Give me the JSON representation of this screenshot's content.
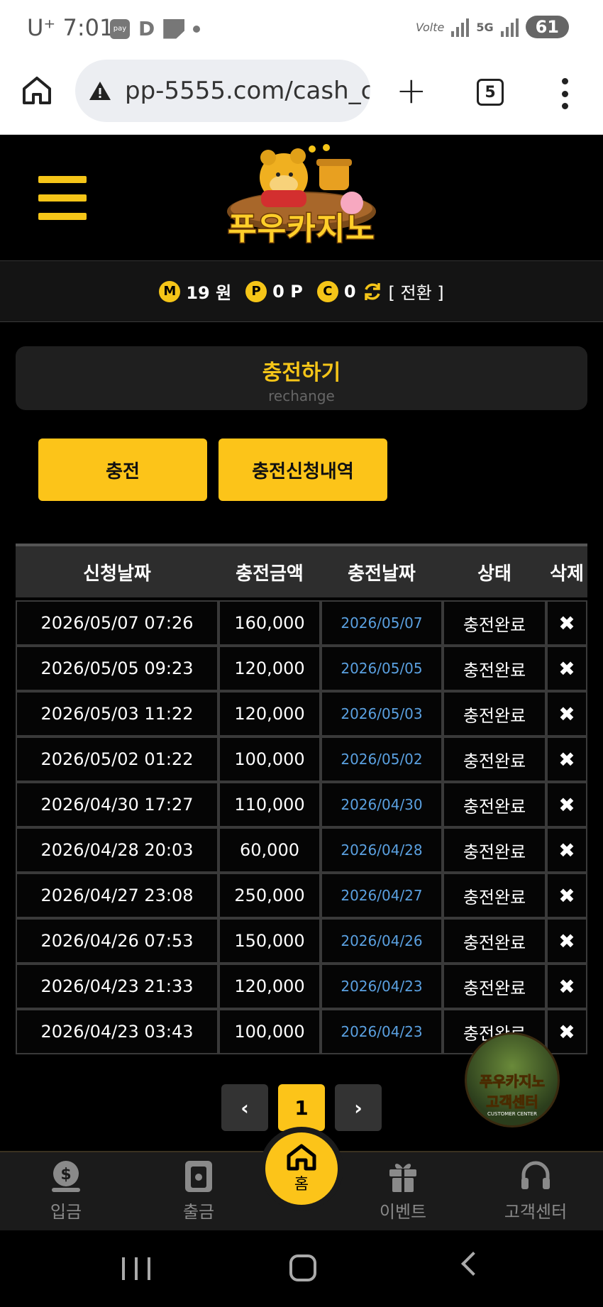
{
  "status_bar": {
    "carrier": "U⁺",
    "time": "7:01",
    "battery": "61",
    "network": "5G",
    "volte": "Volte"
  },
  "browser": {
    "url": "pp-5555.com/cash_c",
    "tab_count": "5"
  },
  "header": {
    "logo_text": "푸우카지노"
  },
  "points": {
    "money_icon": "M",
    "money": "19 원",
    "point_icon": "P",
    "point": "0 P",
    "coin_icon": "C",
    "coin": "0",
    "convert_label": "[ 전환 ]"
  },
  "section": {
    "title": "충전하기",
    "subtitle": "rechange"
  },
  "buttons": {
    "charge": "충전",
    "history": "충전신청내역"
  },
  "table": {
    "headers": [
      "신청날짜",
      "충전금액",
      "충전날짜",
      "상태",
      "삭제"
    ],
    "rows": [
      {
        "req": "2026/05/07 07:26",
        "amount": "160,000",
        "date": "2026/05/07",
        "status": "충전완료",
        "del": "✖"
      },
      {
        "req": "2026/05/05 09:23",
        "amount": "120,000",
        "date": "2026/05/05",
        "status": "충전완료",
        "del": "✖"
      },
      {
        "req": "2026/05/03 11:22",
        "amount": "120,000",
        "date": "2026/05/03",
        "status": "충전완료",
        "del": "✖"
      },
      {
        "req": "2026/05/02 01:22",
        "amount": "100,000",
        "date": "2026/05/02",
        "status": "충전완료",
        "del": "✖"
      },
      {
        "req": "2026/04/30 17:27",
        "amount": "110,000",
        "date": "2026/04/30",
        "status": "충전완료",
        "del": "✖"
      },
      {
        "req": "2026/04/28 20:03",
        "amount": "60,000",
        "date": "2026/04/28",
        "status": "충전완료",
        "del": "✖"
      },
      {
        "req": "2026/04/27 23:08",
        "amount": "250,000",
        "date": "2026/04/27",
        "status": "충전완료",
        "del": "✖"
      },
      {
        "req": "2026/04/26 07:53",
        "amount": "150,000",
        "date": "2026/04/26",
        "status": "충전완료",
        "del": "✖"
      },
      {
        "req": "2026/04/23 21:33",
        "amount": "120,000",
        "date": "2026/04/23",
        "status": "충전완료",
        "del": "✖"
      },
      {
        "req": "2026/04/23 03:43",
        "amount": "100,000",
        "date": "2026/04/23",
        "status": "충전완료",
        "del": "✖"
      }
    ]
  },
  "pagination": {
    "prev": "‹",
    "current": "1",
    "next": "›"
  },
  "floating_support": {
    "title": "푸우카지노",
    "subtitle": "고객센터",
    "english": "CUSTOMER CENTER"
  },
  "bottom_nav": {
    "deposit": "입금",
    "withdraw": "출금",
    "home": "홈",
    "event": "이벤트",
    "support": "고객센터"
  },
  "colors": {
    "accent": "#fcc419",
    "link_blue": "#5aa0e0"
  }
}
